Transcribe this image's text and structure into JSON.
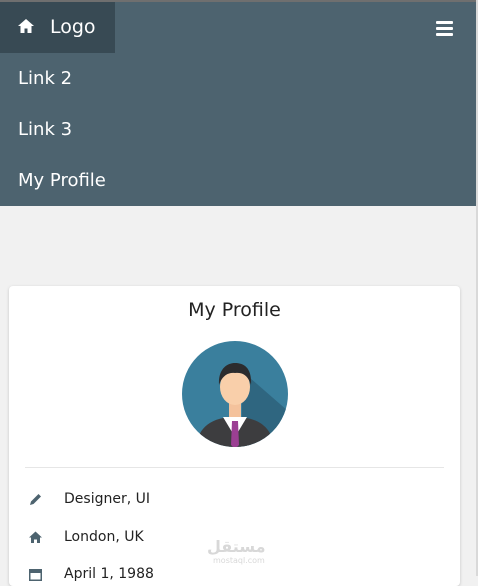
{
  "nav": {
    "logo_label": "Logo",
    "links": [
      "Link 2",
      "Link 3",
      "My Profile"
    ],
    "menu_icon": "hamburger-icon",
    "logo_icon": "home-icon"
  },
  "profile": {
    "title": "My Profile",
    "avatar_icon": "person-avatar-icon",
    "items": [
      {
        "icon": "pencil-icon",
        "text": "Designer, UI"
      },
      {
        "icon": "home-icon",
        "text": "London, UK"
      },
      {
        "icon": "calendar-icon",
        "text": "April 1, 1988"
      }
    ]
  },
  "watermark": {
    "text": "مستقل",
    "sub": "mostaql.com"
  },
  "colors": {
    "nav_bg": "#4d636f",
    "logo_bg": "#384a54",
    "page_bg": "#f1f1f1",
    "icon": "#4d636f"
  }
}
